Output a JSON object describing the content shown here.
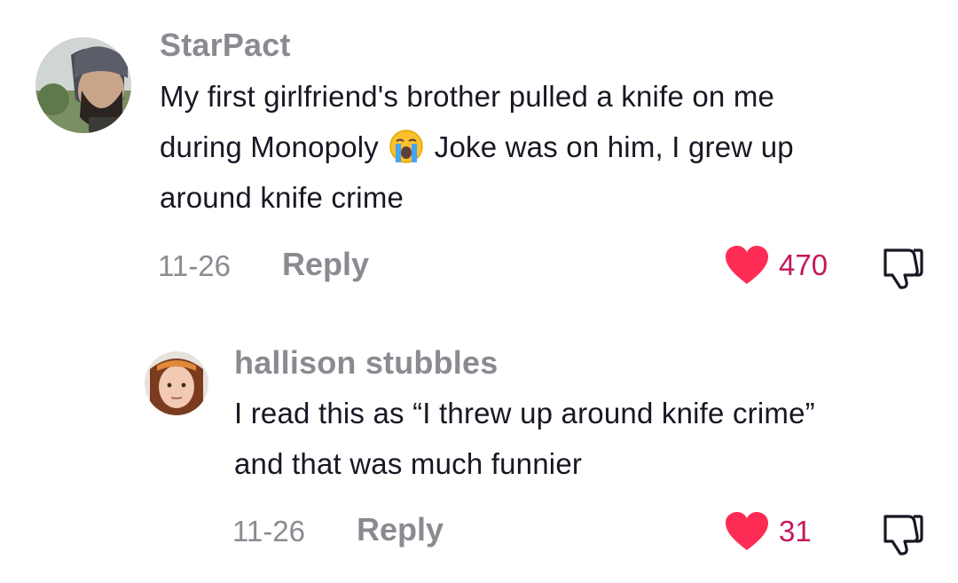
{
  "comments": [
    {
      "username": "StarPact",
      "text_line1": "My first girlfriend's brother pulled a knife on me",
      "text_line2a": "during Monopoly",
      "text_line2b": "Joke was on him, I grew up",
      "text_line3": "around knife crime",
      "date": "11-26",
      "reply_label": "Reply",
      "likes": "470",
      "liked": true
    },
    {
      "username": "hallison stubbles",
      "text_line1": "I read this as “I threw up around knife crime”",
      "text_line2": "and that was much funnier",
      "date": "11-26",
      "reply_label": "Reply",
      "likes": "31",
      "liked": true
    }
  ],
  "colors": {
    "username": "#8a8b91",
    "text": "#161823",
    "like_heart": "#fe2c55",
    "like_count": "#c2185b",
    "meta": "#8a8b91"
  },
  "icons": {
    "liked": "heart-filled-icon",
    "dislike": "thumbs-down-icon",
    "emoji": "loudly-crying-face-emoji"
  }
}
